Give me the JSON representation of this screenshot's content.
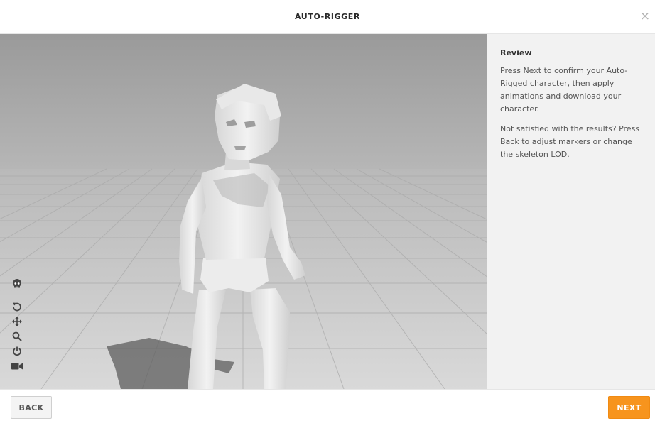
{
  "header": {
    "title": "AUTO-RIGGER",
    "close_glyph": "×"
  },
  "viewport": {
    "tools": [
      "skull-icon",
      "rotate-icon",
      "move-icon",
      "zoom-icon",
      "power-icon",
      "camera-icon"
    ]
  },
  "panel": {
    "heading": "Review",
    "paragraph1": "Press Next to confirm your Auto-Rigged character, then apply animations and download your character.",
    "paragraph2": "Not satisfied with the results? Press Back to adjust markers or change the skeleton LOD."
  },
  "footer": {
    "back_label": "BACK",
    "next_label": "NEXT"
  },
  "colors": {
    "accent": "#f7941d",
    "panel_bg": "#f2f2f2"
  }
}
